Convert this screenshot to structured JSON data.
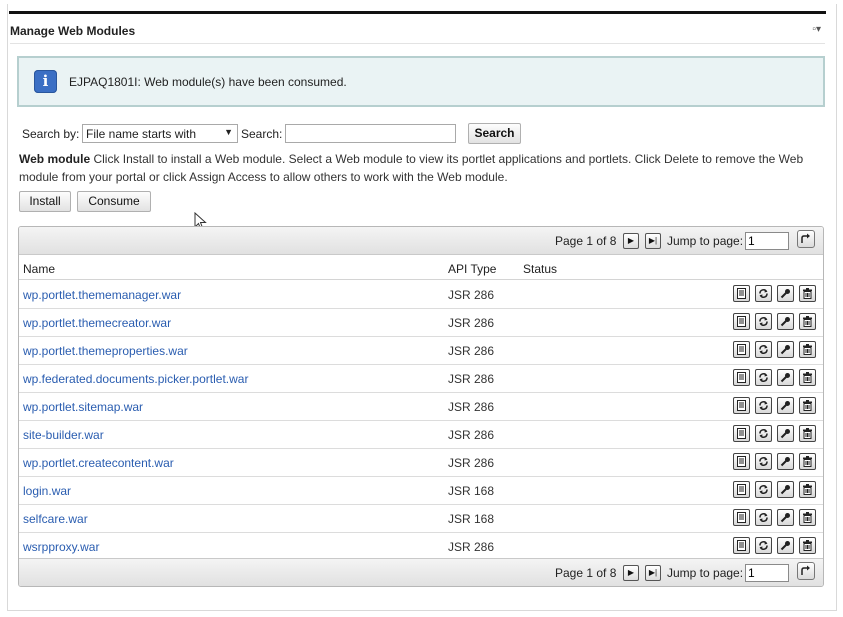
{
  "portlet": {
    "title": "Manage Web Modules",
    "menu_glyph": "▫▾"
  },
  "message": {
    "icon_glyph": "i",
    "text": "EJPAQ1801I: Web module(s) have been consumed."
  },
  "search": {
    "by_label": "Search by:",
    "selected_option": "File name starts with",
    "search_label": "Search:",
    "value": "",
    "button_label": "Search"
  },
  "description": {
    "bold": "Web module",
    "text": " Click Install to install a Web module. Select a Web module to view its portlet applications and portlets. Click Delete to remove the Web module from your portal or click Assign Access to allow others to work with the Web module."
  },
  "actions": {
    "install_label": "Install",
    "consume_label": "Consume"
  },
  "pager": {
    "page_text": "Page 1 of 8",
    "jump_label": "Jump to page:",
    "jump_value": "1"
  },
  "table": {
    "headers": {
      "name": "Name",
      "api": "API Type",
      "status": "Status"
    },
    "rows": [
      {
        "name": "wp.portlet.thememanager.war",
        "api": "JSR 286"
      },
      {
        "name": "wp.portlet.themecreator.war",
        "api": "JSR 286"
      },
      {
        "name": "wp.portlet.themeproperties.war",
        "api": "JSR 286"
      },
      {
        "name": "wp.federated.documents.picker.portlet.war",
        "api": "JSR 286"
      },
      {
        "name": "wp.portlet.sitemap.war",
        "api": "JSR 286"
      },
      {
        "name": "site-builder.war",
        "api": "JSR 286"
      },
      {
        "name": "wp.portlet.createcontent.war",
        "api": "JSR 286"
      },
      {
        "name": "login.war",
        "api": "JSR 168"
      },
      {
        "name": "selfcare.war",
        "api": "JSR 168"
      },
      {
        "name": "wsrpproxy.war",
        "api": "JSR 286"
      }
    ],
    "row_action_icons": [
      "view-details-icon",
      "update-icon",
      "assign-access-icon",
      "delete-icon"
    ]
  },
  "colors": {
    "link": "#2a5db0",
    "message_bg": "#eaf3f4",
    "info_icon": "#3b6fc4"
  }
}
